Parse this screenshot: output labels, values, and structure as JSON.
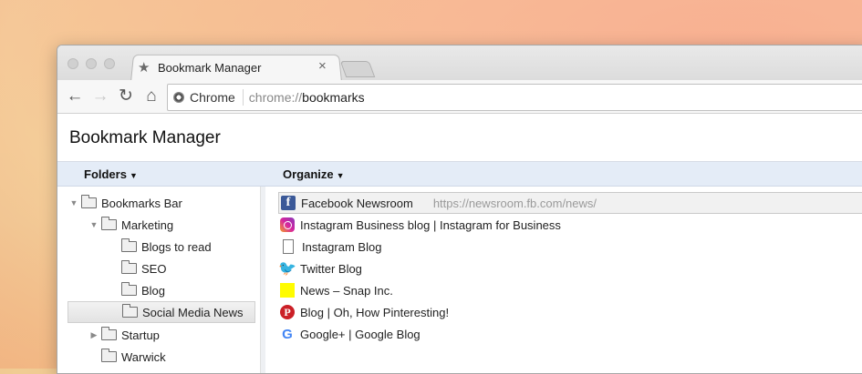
{
  "tab": {
    "title": "Bookmark Manager",
    "close": "×",
    "star": "★"
  },
  "nav": {
    "back": "←",
    "forward": "→",
    "reload": "↻",
    "home": "⌂"
  },
  "omnibox": {
    "chip_label": "Chrome",
    "url_scheme": "chrome://",
    "url_host": "bookmarks"
  },
  "app": {
    "title": "Bookmark Manager"
  },
  "menus": {
    "folders": "Folders",
    "organize": "Organize",
    "caret": "▼"
  },
  "tree": [
    {
      "label": "Bookmarks Bar",
      "expanded": true
    },
    {
      "label": "Marketing",
      "expanded": true
    },
    {
      "label": "Blogs to read"
    },
    {
      "label": "SEO"
    },
    {
      "label": "Blog"
    },
    {
      "label": "Social Media News",
      "selected": true
    },
    {
      "label": "Startup",
      "expanded": false
    },
    {
      "label": "Warwick"
    }
  ],
  "twisty": {
    "open": "▼",
    "closed": "▶"
  },
  "bookmarks": [
    {
      "title": "Facebook Newsroom",
      "url": "https://newsroom.fb.com/news/",
      "icon": "facebook-icon",
      "glyph": "f",
      "selected": true
    },
    {
      "title": "Instagram Business blog | Instagram for Business",
      "icon": "instagram-icon",
      "glyph": ""
    },
    {
      "title": "Instagram Blog",
      "icon": "document-icon",
      "glyph": ""
    },
    {
      "title": "Twitter Blog",
      "icon": "twitter-icon",
      "glyph": "🐦"
    },
    {
      "title": "News – Snap Inc.",
      "icon": "snapchat-icon",
      "glyph": ""
    },
    {
      "title": "Blog | Oh, How Pinteresting!",
      "icon": "pinterest-icon",
      "glyph": "P"
    },
    {
      "title": "Google+ | Google Blog",
      "icon": "google-icon",
      "glyph": "G"
    }
  ],
  "colors": {
    "menubar": "#e4ecf7",
    "facebook": "#3b5998",
    "twitter": "#1da1f2",
    "pinterest": "#cb2027",
    "snap": "#fffc00"
  }
}
